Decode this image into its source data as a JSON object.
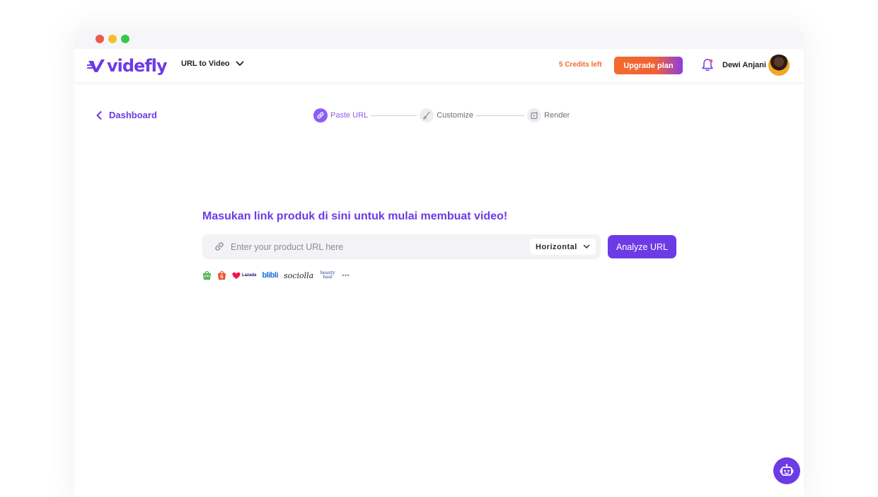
{
  "app": {
    "logo_text": "videfly",
    "brand_color": "#6c3be6",
    "accent_orange": "#f26b2d"
  },
  "header": {
    "mode_select": {
      "selected": "URL to Video"
    },
    "credits": "5 Credits left",
    "upgrade_label": "Upgrade plan",
    "user_name": "Dewi Anjani"
  },
  "back_link": {
    "label": "Dashboard"
  },
  "stepper": {
    "steps": [
      {
        "label": "Paste URL",
        "icon": "link-icon",
        "state": "active"
      },
      {
        "label": "Customize",
        "icon": "brush-icon",
        "state": "idle"
      },
      {
        "label": "Render",
        "icon": "render-icon",
        "state": "idle"
      }
    ]
  },
  "main": {
    "headline": "Masukan link produk di sini untuk mulai membuat video!",
    "url_input": {
      "placeholder": "Enter your product URL here",
      "value": ""
    },
    "orientation": {
      "selected": "Horizontal"
    },
    "analyze_label": "Analyze URL",
    "platforms": [
      "Tokopedia",
      "Shopee",
      "Lazada",
      "blibli",
      "sociolla",
      "beauty haul",
      "more"
    ]
  },
  "platform_labels": {
    "lazada": "Lazada",
    "blibli": "blibli",
    "sociolla": "sociolla",
    "beauty_haul": "beauty haul",
    "more": "•••"
  }
}
